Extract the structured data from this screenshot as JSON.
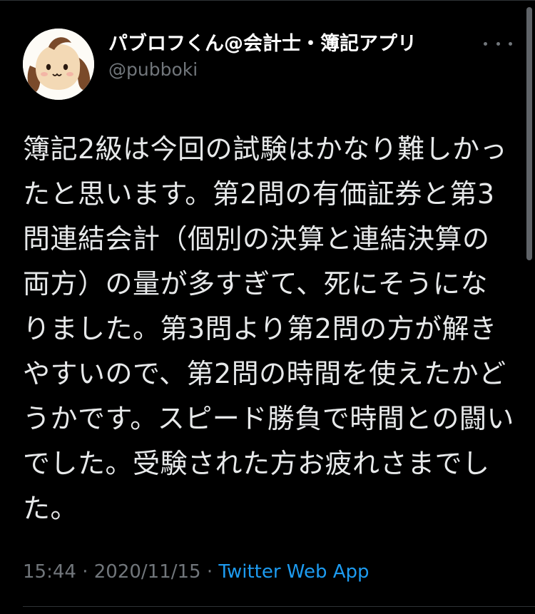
{
  "author": {
    "display_name": "パブロフくん@会計士・簿記アプリ",
    "handle": "@pubboki",
    "avatar_icon": "dog-avatar-icon"
  },
  "tweet": {
    "text": "簿記2級は今回の試験はかなり難しかったと思います。第2問の有価証券と第3問連結会計（個別の決算と連結決算の両方）の量が多すぎて、死にそうになりました。第3問より第2問の方が解きやすいので、第2問の時間を使えたかどうかです。スピード勝負で時間との闘いでした。受験された方お疲れさまでした。"
  },
  "meta": {
    "time": "15:44",
    "separator_1": "·",
    "date": "2020/11/15",
    "separator_2": "·",
    "source": "Twitter Web App"
  },
  "icons": {
    "more": "more-horizontal-icon"
  },
  "colors": {
    "background": "#000000",
    "primary_text": "#e7e9ea",
    "secondary_text": "#71767b",
    "link": "#1d9bf0",
    "divider": "#2f3336"
  }
}
